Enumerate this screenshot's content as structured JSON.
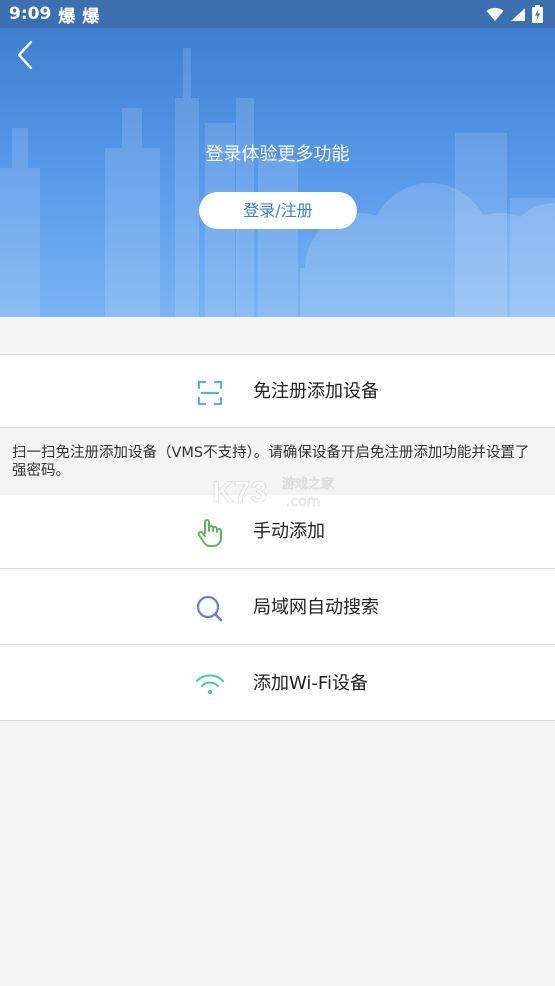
{
  "status_bar": {
    "time": "9:09",
    "notif_icons": [
      "爆",
      "爆"
    ],
    "right_icons": [
      "wifi-icon",
      "signal-icon",
      "battery-charging-icon"
    ]
  },
  "header": {
    "tagline": "登录体验更多功能",
    "login_button": "登录/注册",
    "back_icon": "back-arrow-icon",
    "colors": {
      "gradient_top": "#3f7fd0",
      "gradient_bottom": "#7ab4f3"
    }
  },
  "options": {
    "register_free": {
      "label": "免注册添加设备",
      "icon": "scan-frame-icon",
      "color": "#5ab0e6"
    },
    "register_free_note": "扫一扫免注册添加设备（VMS不支持）。请确保设备开启免注册添加功能并设置了强密码。",
    "manual": {
      "label": "手动添加",
      "icon": "hand-pointer-icon",
      "color": "#5cb85c"
    },
    "lan_search": {
      "label": "局域网自动搜索",
      "icon": "magnifier-icon",
      "color": "#6b7fd6"
    },
    "wifi": {
      "label": "添加Wi-Fi设备",
      "icon": "wifi-icon",
      "color": "#4ec9b0"
    }
  },
  "watermark": {
    "brand": "K73",
    "sub": "游戏之家",
    "domain": ".com"
  }
}
